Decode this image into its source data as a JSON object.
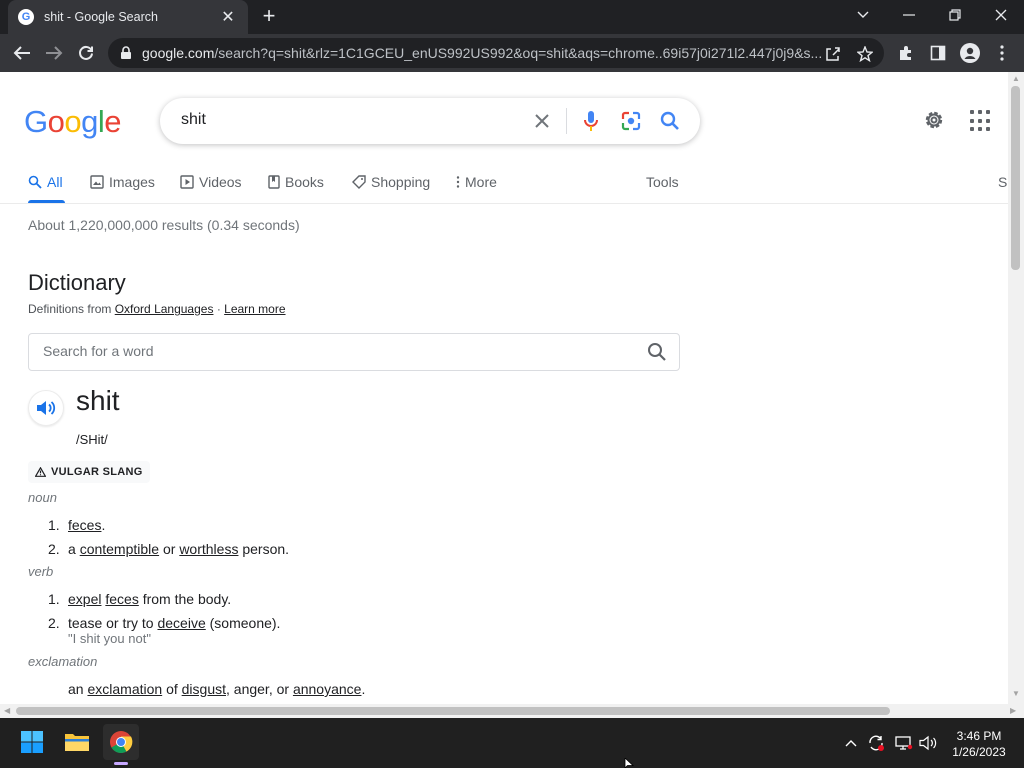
{
  "browser": {
    "tab_title": "shit - Google Search",
    "favicon_letter": "G",
    "url_host": "google.com",
    "url_path": "/search?q=shit&rlz=1C1GCEU_enUS992US992&oq=shit&aqs=chrome..69i57j0i271l2.447j0j9&s..."
  },
  "google": {
    "logo_letters": [
      "G",
      "o",
      "o",
      "g",
      "l",
      "e"
    ],
    "query": "shit",
    "tabs": [
      "All",
      "Images",
      "Videos",
      "Books",
      "Shopping",
      "More"
    ],
    "tools_label": "Tools",
    "right_edge_label": "S",
    "stats": "About 1,220,000,000 results (0.34 seconds)"
  },
  "dictionary": {
    "title": "Dictionary",
    "sub_prefix": "Definitions from",
    "source_link": "Oxford Languages",
    "separator": "·",
    "learn_more": "Learn more",
    "search_placeholder": "Search for a word",
    "headword": "shit",
    "phonetic": "/SHit/",
    "register_label": "VULGAR SLANG",
    "noun": {
      "pos": "noun",
      "defs": [
        {
          "num": "1.",
          "w1": "feces",
          "end": "."
        },
        {
          "num": "2.",
          "pre": "a",
          "w1": "contemptible",
          "mid": "or",
          "w2": "worthless",
          "end": "person."
        }
      ]
    },
    "verb": {
      "pos": "verb",
      "defs": [
        {
          "num": "1.",
          "w1": "expel",
          "w2": "feces",
          "end": "from the body."
        },
        {
          "num": "2.",
          "pre": "tease or try to",
          "w1": "deceive",
          "end": "(someone).",
          "example": "\"I shit you not\""
        }
      ]
    },
    "exclamation": {
      "pos": "exclamation",
      "pre": "an",
      "w1": "exclamation",
      "mid": "of",
      "w2": "disgust",
      "mid2": ", anger, or",
      "w3": "annoyance",
      "end": "."
    }
  },
  "taskbar": {
    "time": "3:46 PM",
    "date": "1/26/2023"
  },
  "colors": {
    "google_blue": "#4285f4",
    "active_tab_blue": "#1a73e8",
    "chrome_dark": "#35363a",
    "taskbar": "#202020"
  }
}
